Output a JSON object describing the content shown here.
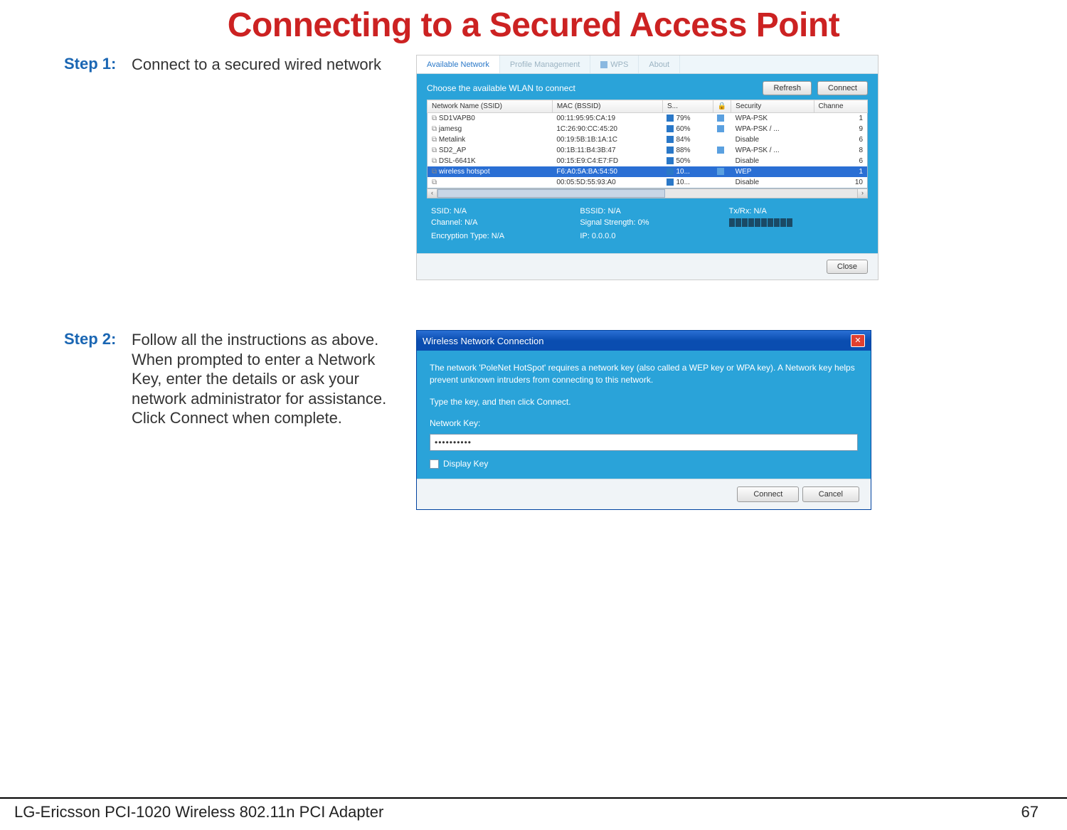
{
  "page": {
    "title": "Connecting to a Secured Access Point",
    "footer_left": "LG-Ericsson PCI-1020 Wireless 802.11n PCI Adapter",
    "footer_right": "67"
  },
  "steps": {
    "s1": {
      "label": "Step 1:",
      "text": "Connect to a secured wired network"
    },
    "s2": {
      "label": "Step 2:",
      "text": "Follow all the instructions as above. When prompted to enter a Network Key, enter the details or ask your network administrator for assistance. Click Connect when complete."
    }
  },
  "wlan": {
    "tabs": {
      "available": "Available Network",
      "profile": "Profile Management",
      "wps": "WPS",
      "about": "About"
    },
    "caption": "Choose the available WLAN to connect",
    "buttons": {
      "refresh": "Refresh",
      "connect": "Connect",
      "close": "Close"
    },
    "headers": {
      "ssid": "Network Name (SSID)",
      "mac": "MAC (BSSID)",
      "signal": "S...",
      "security": "Security",
      "channel": "Channe"
    },
    "rows": [
      {
        "ssid": "SD1VAPB0",
        "mac": "00:11:95:95:CA:19",
        "sig": "79%",
        "lock": true,
        "sec": "WPA-PSK",
        "ch": "1"
      },
      {
        "ssid": "jamesg",
        "mac": "1C:26:90:CC:45:20",
        "sig": "60%",
        "lock": true,
        "sec": "WPA-PSK / ...",
        "ch": "9"
      },
      {
        "ssid": "Metalink",
        "mac": "00:19:5B:1B:1A:1C",
        "sig": "84%",
        "lock": false,
        "sec": "Disable",
        "ch": "6"
      },
      {
        "ssid": "SD2_AP",
        "mac": "00:1B:11:B4:3B:47",
        "sig": "88%",
        "lock": true,
        "sec": "WPA-PSK / ...",
        "ch": "8"
      },
      {
        "ssid": "DSL-6641K",
        "mac": "00:15:E9:C4:E7:FD",
        "sig": "50%",
        "lock": false,
        "sec": "Disable",
        "ch": "6"
      },
      {
        "ssid": "wireless hotspot",
        "mac": "F6:A0:5A:BA:54:50",
        "sig": "10...",
        "lock": true,
        "sec": "WEP",
        "ch": "1",
        "selected": true
      },
      {
        "ssid": "",
        "mac": "00:05:5D:55:93:A0",
        "sig": "10...",
        "lock": false,
        "sec": "Disable",
        "ch": "10"
      }
    ],
    "info": {
      "ssid": "SSID: N/A",
      "bssid": "BSSID: N/A",
      "txrx": "Tx/Rx: N/A",
      "channel": "Channel: N/A",
      "signal": "Signal Strength: 0%",
      "enc": "Encryption Type: N/A",
      "ip": "IP: 0.0.0.0"
    }
  },
  "dialog": {
    "title": "Wireless Network Connection",
    "body1": "The network 'PoleNet HotSpot' requires a network key (also called a WEP key or WPA key). A Network key helps prevent unknown intruders from connecting to this network.",
    "body2": "Type the key, and then click Connect.",
    "key_label": "Network Key:",
    "key_value": "••••••••••",
    "display_key": "Display Key",
    "connect": "Connect",
    "cancel": "Cancel"
  }
}
